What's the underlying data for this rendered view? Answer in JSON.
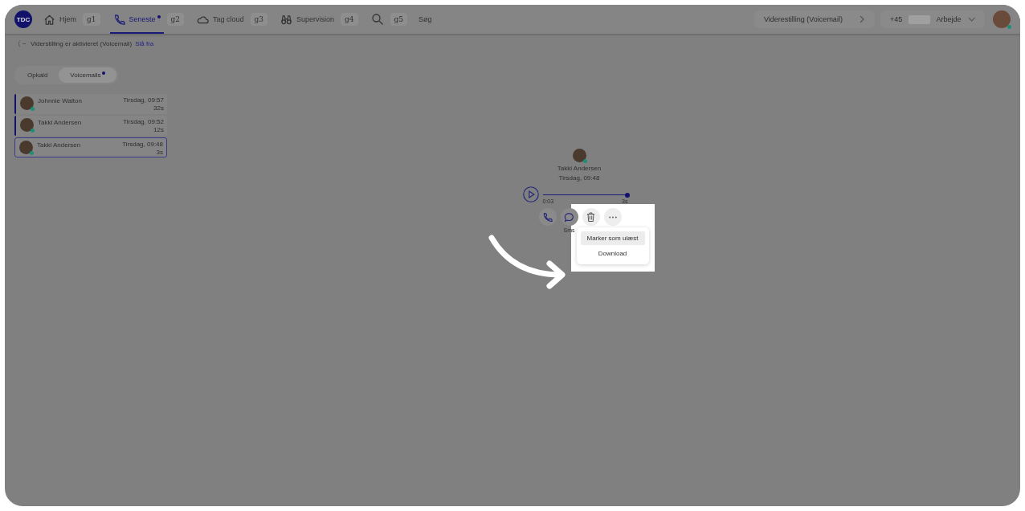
{
  "topbar": {
    "logo": "TDC",
    "tabs": [
      {
        "label": "Hjem",
        "shortcut": "g1",
        "selected": false,
        "unread": false
      },
      {
        "label": "Seneste",
        "shortcut": "g2",
        "selected": true,
        "unread": true
      },
      {
        "label": "Tag cloud",
        "shortcut": "g3",
        "selected": false,
        "unread": false
      },
      {
        "label": "Supervision",
        "shortcut": "g4",
        "selected": false,
        "unread": false
      },
      {
        "label": "Søg",
        "shortcut": "g5",
        "selected": false,
        "unread": false
      }
    ],
    "forwarding": "Viderestilling (Voicemail)",
    "number": {
      "prefix": "+45",
      "label": "Arbejde"
    },
    "user": {
      "online": true
    }
  },
  "notice": {
    "text": "Viderstilling er aktivieret (Voicemail)",
    "link": "Slå fra"
  },
  "segments": [
    {
      "label": "Opkald",
      "selected": false,
      "unread": false
    },
    {
      "label": "Voicemails",
      "selected": true,
      "unread": true
    }
  ],
  "voicemails": [
    {
      "name": "Johnnie Walton",
      "time": "Tirsdag, 09:57",
      "duration": "32s",
      "unread": true,
      "selected": false,
      "online": true
    },
    {
      "name": "Takki Andersen",
      "time": "Tirsdag, 09:52",
      "duration": "12s",
      "unread": true,
      "selected": false,
      "online": true
    },
    {
      "name": "Takki Andersen",
      "time": "Tirsdag, 09:48",
      "duration": "3s",
      "unread": false,
      "selected": true,
      "online": true
    }
  ],
  "detail": {
    "name": "Takki Andersen",
    "time": "Tirsdag, 09:48",
    "online": true,
    "player": {
      "elapsed": "0:03",
      "length": "3s",
      "level": 1
    },
    "actions": [
      {
        "kind": "call"
      },
      {
        "kind": "sms",
        "label": "Sms"
      },
      {
        "kind": "delete"
      },
      {
        "kind": "more"
      }
    ],
    "menu": [
      {
        "label": "Marker som ulæst",
        "selected": true
      },
      {
        "label": "Download",
        "selected": false
      }
    ]
  }
}
